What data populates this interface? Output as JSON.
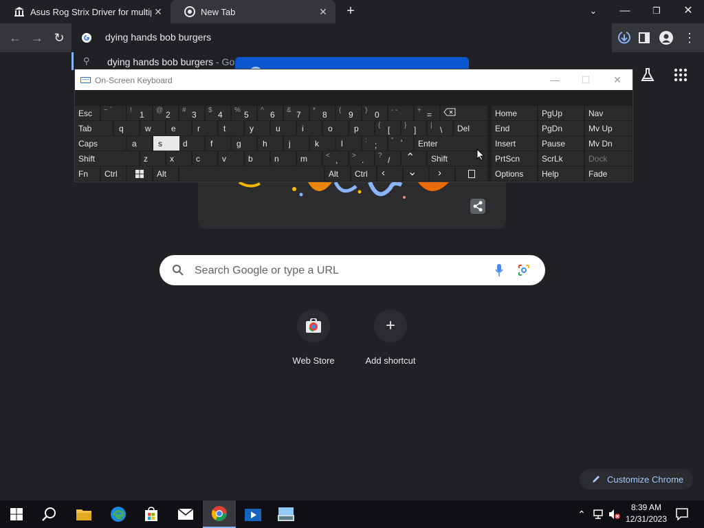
{
  "tabs": [
    {
      "title": "Asus Rog Strix Driver for multiple",
      "icon": "museum-icon"
    },
    {
      "title": "New Tab",
      "icon": "chrome-icon"
    }
  ],
  "omnibox": {
    "text": "dying hands bob burgers",
    "suggestion_query": "dying hands bob burgers",
    "suggestion_hint": " - Go"
  },
  "osk": {
    "title": "On-Screen Keyboard",
    "row1": {
      "esc": "Esc",
      "tilde_s": "~ `",
      "k1s": "!",
      "k1": "1",
      "k2s": "@",
      "k2": "2",
      "k3s": "#",
      "k3": "3",
      "k4s": "$",
      "k4": "4",
      "k5s": "%",
      "k5": "5",
      "k6s": "^",
      "k6": "6",
      "k7s": "&",
      "k7": "7",
      "k8s": "*",
      "k8": "8",
      "k9s": "(",
      "k9": "9",
      "k0s": ")",
      "k0": "0",
      "kminus": "- -",
      "kplus_s": "+",
      "kplus": "="
    },
    "row2": {
      "tab": "Tab",
      "q": "q",
      "w": "w",
      "e": "e",
      "r": "r",
      "t": "t",
      "y": "y",
      "u": "u",
      "i": "i",
      "o": "o",
      "p": "p",
      "lb_s": "{",
      "lb": "[",
      "rb_s": "}",
      "rb": "]",
      "pipe_s": "|",
      "bs": "\\",
      "del": "Del"
    },
    "row3": {
      "caps": "Caps",
      "a": "a",
      "s": "s",
      "d": "d",
      "f": "f",
      "g": "g",
      "h": "h",
      "j": "j",
      "k": "k",
      "l": "l",
      "colon_s": ":",
      "semi": ";",
      "quote_s": "\"",
      "quote": "'",
      "enter": "Enter"
    },
    "row4": {
      "shift": "Shift",
      "z": "z",
      "x": "x",
      "c": "c",
      "v": "v",
      "b": "b",
      "n": "n",
      "m": "m",
      "comma_s": "<",
      "comma": ",",
      "period_s": ">",
      "period": ".",
      "slash_s": "?",
      "slash": "/",
      "rshift": "Shift"
    },
    "row5": {
      "fn": "Fn",
      "ctrl": "Ctrl",
      "alt": "Alt",
      "ralt": "Alt",
      "rctrl": "Ctrl"
    },
    "nav": {
      "home": "Home",
      "pgup": "PgUp",
      "navk": "Nav",
      "end": "End",
      "pgdn": "PgDn",
      "mvup": "Mv Up",
      "insert": "Insert",
      "pause": "Pause",
      "mvdn": "Mv Dn",
      "prtscn": "PrtScn",
      "scrlk": "ScrLk",
      "dock": "Dock",
      "options": "Options",
      "help": "Help",
      "fade": "Fade"
    }
  },
  "search": {
    "placeholder": "Search Google or type a URL"
  },
  "shortcuts": [
    {
      "label": "Web Store"
    },
    {
      "label": "Add shortcut"
    }
  ],
  "customize": {
    "label": "Customize Chrome"
  },
  "taskbar": {
    "time": "8:39 AM",
    "date": "12/31/2023"
  },
  "colors": {
    "accent": "#8ab4f8",
    "blue_popup": "#0b57d0",
    "chrome_bg": "#202124",
    "toolbar": "#35363a"
  }
}
